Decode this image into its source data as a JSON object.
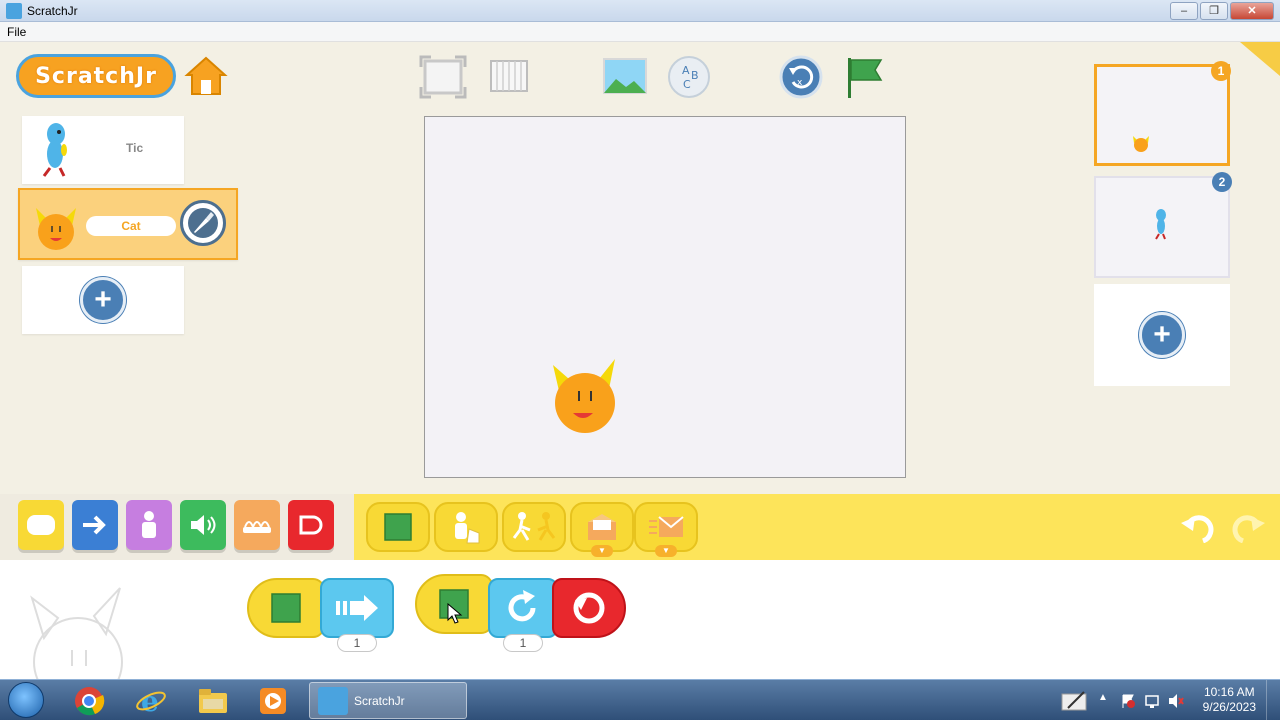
{
  "window": {
    "title": "ScratchJr",
    "minimize": "–",
    "maximize": "❐",
    "close": "✕"
  },
  "menu": {
    "file": "File"
  },
  "header": {
    "logo_text": "ScratchJr"
  },
  "sprites": [
    {
      "name": "Tic"
    },
    {
      "name": "Cat"
    }
  ],
  "pages": [
    {
      "number": "1"
    },
    {
      "number": "2"
    }
  ],
  "script": {
    "block1_count": "1",
    "block2_count": "1"
  },
  "taskbar": {
    "task_label": "ScratchJr",
    "time": "10:16 AM",
    "date": "9/26/2023"
  },
  "colors": {
    "trigger_yellow": "#f8d935",
    "motion_blue": "#5cc8ef",
    "end_red": "#e8282d",
    "accent_orange": "#f5a623",
    "add_blue": "#4a7fb5"
  }
}
